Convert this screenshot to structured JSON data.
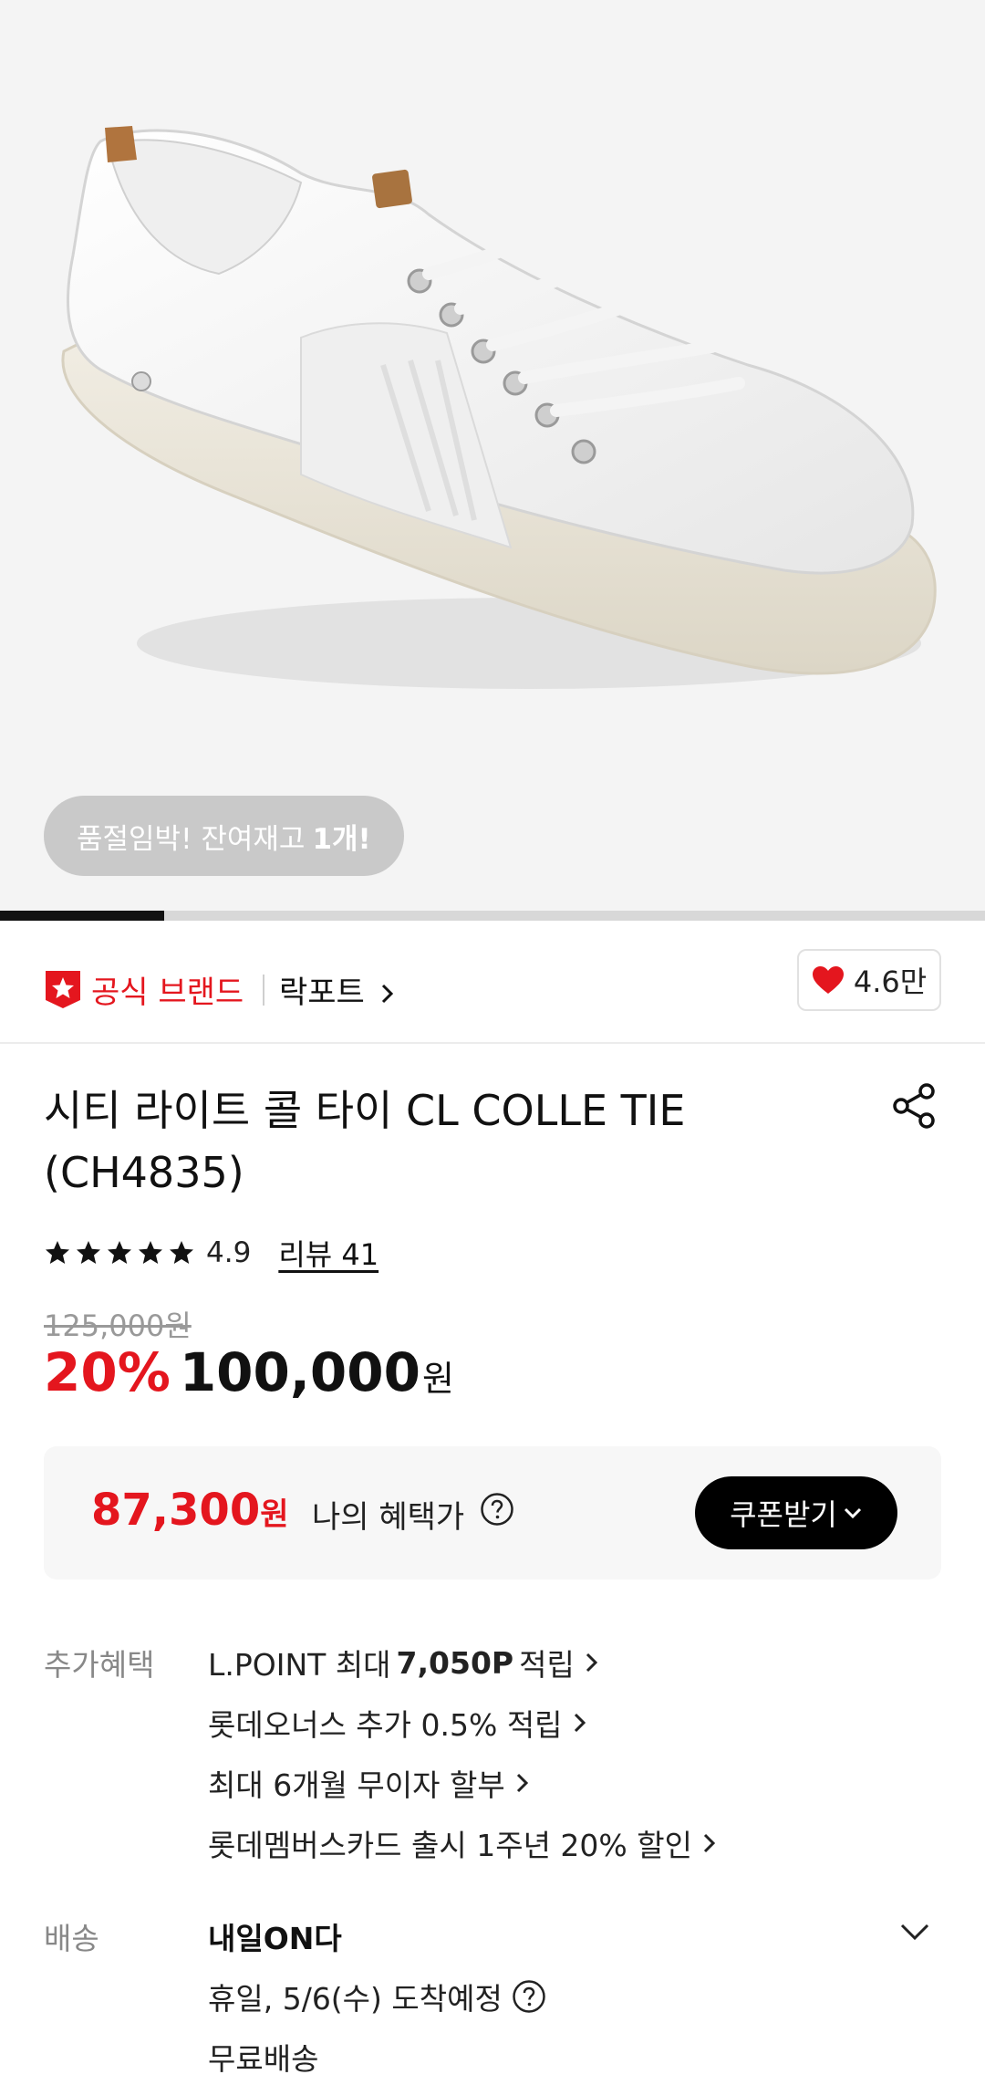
{
  "stock_notice": {
    "text": "품절임박! 잔여재고",
    "count": "1개!"
  },
  "image_gallery": {
    "position": 1,
    "total": 6
  },
  "brand": {
    "official_label": "공식 브랜드",
    "name": "락포트"
  },
  "like": {
    "count": "4.6만"
  },
  "product": {
    "title": "시티 라이트 콜 타이 CL COLLE TIE (CH4835)"
  },
  "rating": {
    "score": "4.9",
    "stars": 5,
    "review_link": "리뷰 41"
  },
  "price": {
    "original": "125,000원",
    "discount": "20%",
    "sale": "100,000",
    "currency": "원"
  },
  "my_benefit": {
    "price": "87,300",
    "currency": "원",
    "label": "나의 혜택가",
    "coupon_button": "쿠폰받기"
  },
  "benefits": {
    "label": "추가혜택",
    "items": [
      {
        "prefix": "L.POINT 최대",
        "highlight": "7,050P",
        "suffix": "적립"
      },
      {
        "text": "롯데오너스 추가 0.5% 적립"
      },
      {
        "text": "최대 6개월 무이자 할부"
      },
      {
        "text": "롯데멤버스카드 출시 1주년 20% 할인"
      }
    ]
  },
  "delivery": {
    "label": "배송",
    "title": "내일ON다",
    "arrival": "휴일, 5/6(수) 도착예정",
    "fee": "무료배송"
  },
  "colors": {
    "accent": "#e4161e",
    "text": "#111111",
    "muted": "#888888"
  },
  "icons": [
    "badge-star-icon",
    "heart-icon",
    "share-icon",
    "star-icon",
    "question-icon",
    "chevron-right-icon",
    "chevron-down-icon"
  ]
}
